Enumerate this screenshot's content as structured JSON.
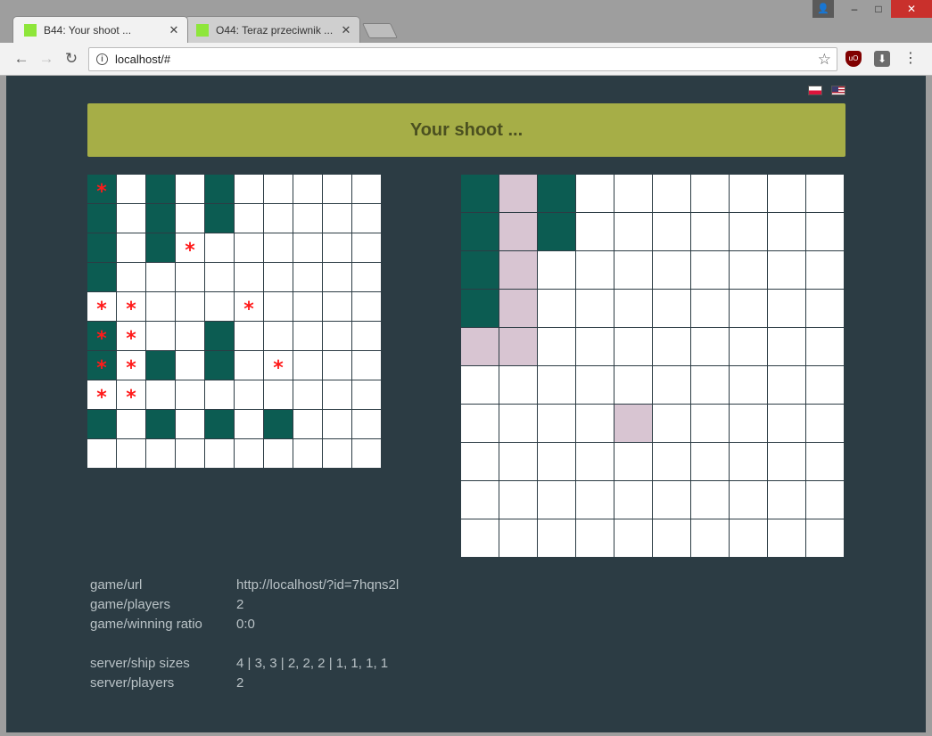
{
  "browser": {
    "tabs": [
      {
        "title": "B44: Your shoot ...",
        "active": true
      },
      {
        "title": "O44: Teraz przeciwnik ...",
        "active": false
      }
    ],
    "url": "localhost/#"
  },
  "languages": [
    "pl",
    "us"
  ],
  "banner": {
    "text": "Your shoot ...",
    "color": "#a6ae47"
  },
  "colors": {
    "background": "#2c3c44",
    "ship": "#0c5c52",
    "miss": "#d8c5d2",
    "hit": "#ff1a1a",
    "water": "#ffffff"
  },
  "own_board": {
    "legend": {
      ".": "water",
      "S": "ship",
      "X": "ship-hit",
      "o": "miss"
    },
    "rows": [
      "X.S.S.....",
      "S.S.S.....",
      "S.So......",
      "S.........",
      "oo...o....",
      "Xo..S.....",
      "XoS.S.o...",
      "oo........",
      "S.S.S.S...",
      ".........."
    ]
  },
  "enemy_board": {
    "legend": {
      ".": "unknown",
      "S": "ship-hit",
      "o": "miss"
    },
    "rows": [
      "SoS.......",
      "SoS.......",
      "So........",
      "So........",
      "oo........",
      "..........",
      "....o.....",
      "..........",
      "..........",
      ".........."
    ]
  },
  "info": {
    "game_url_key": "game/url",
    "game_url_val": "http://localhost/?id=7hqns2l",
    "game_players_key": "game/players",
    "game_players_val": "2",
    "winning_ratio_key": "game/winning ratio",
    "winning_ratio_val": "0:0",
    "ship_sizes_key": "server/ship sizes",
    "ship_sizes_val": "4 | 3, 3 | 2, 2, 2 | 1, 1, 1, 1",
    "server_players_key": "server/players",
    "server_players_val": "2"
  }
}
